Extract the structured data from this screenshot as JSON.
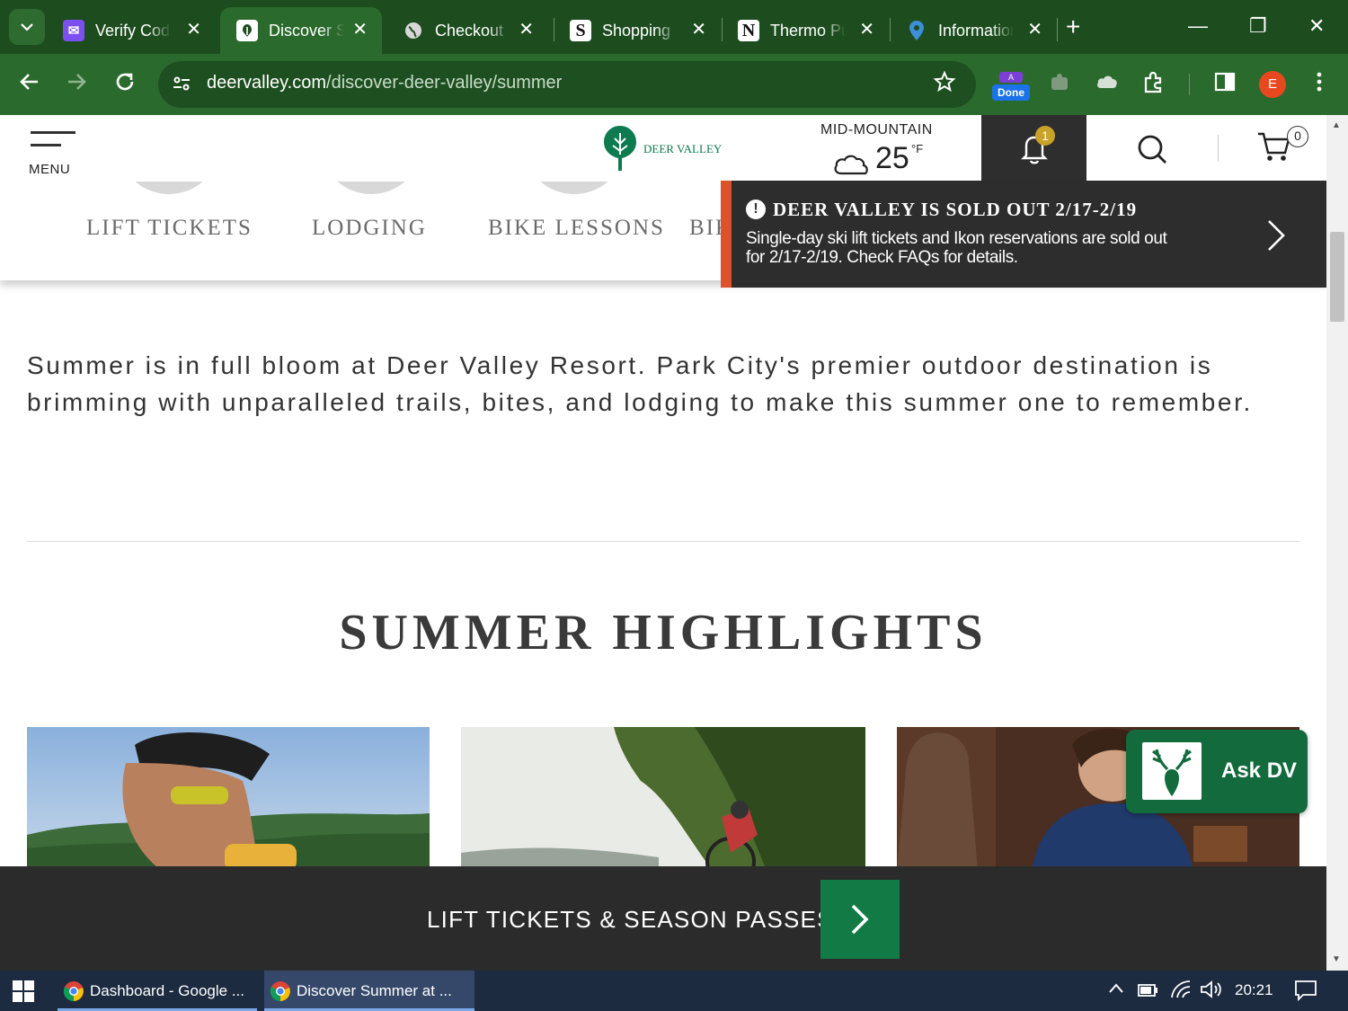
{
  "browser": {
    "tabs": [
      {
        "label": "Verify Code",
        "icon": "mail-icon",
        "active": false
      },
      {
        "label": "Discover Summer at Deer Valley",
        "icon": "deer-valley-icon",
        "active": true
      },
      {
        "label": "Checkout",
        "icon": "globe-icon",
        "active": false
      },
      {
        "label": "Shopping",
        "icon": "s-icon",
        "active": false
      },
      {
        "label": "Thermo Pulse",
        "icon": "n-icon",
        "active": false
      },
      {
        "label": "Information",
        "icon": "pin-icon",
        "active": false
      }
    ],
    "tab_glyphs": {
      "mail": "✉",
      "s": "S",
      "n": "N"
    },
    "new_tab": "+",
    "close_glyph": "✕",
    "window": {
      "minimize": "—",
      "restore": "❐",
      "close": "✕"
    },
    "url_host": "deervalley.com",
    "url_path": "/discover-deer-valley/summer",
    "extension_done_label": "Done",
    "extension_top_label": "A",
    "profile_initial": "E",
    "colors": {
      "frame": "#1d4d1f",
      "toolbar": "#2b6a2d"
    }
  },
  "site": {
    "menu_label": "MENU",
    "logo_text": "DEER VALLEY",
    "weather": {
      "label": "MID-MOUNTAIN",
      "temp": "25",
      "unit": "°F",
      "icon": "cloud-icon"
    },
    "notification_count": "1",
    "cart_count": "0",
    "subnav": [
      "LIFT TICKETS",
      "LODGING",
      "BIKE LESSONS",
      "BIKE"
    ],
    "alert": {
      "title": "DEER VALLEY IS SOLD OUT 2/17-2/19",
      "body": "Single-day ski lift tickets and Ikon reservations are sold out for 2/17-2/19. Check FAQs for details.",
      "icon_glyph": "!"
    },
    "intro": "Summer is in full bloom at Deer Valley Resort. Park City's premier outdoor destination is brimming with unparalleled trails, bites, and lodging to make this summer one to remember.",
    "highlights_title": "SUMMER HIGHLIGHTS",
    "cards": [
      "cyclist-with-beer-photo",
      "mountain-biker-forest-photo",
      "dining-woman-photo"
    ],
    "ask_dv_label": "Ask DV",
    "bottom_bar_label": "LIFT TICKETS & SEASON PASSES",
    "colors": {
      "brand_green": "#127a45",
      "alert_accent": "#d9542b",
      "dark": "#2b2b2b"
    }
  },
  "taskbar": {
    "items": [
      {
        "label": "Dashboard - Google ...",
        "active": false
      },
      {
        "label": "Discover Summer at ...",
        "active": true
      }
    ],
    "time": "20:21"
  }
}
